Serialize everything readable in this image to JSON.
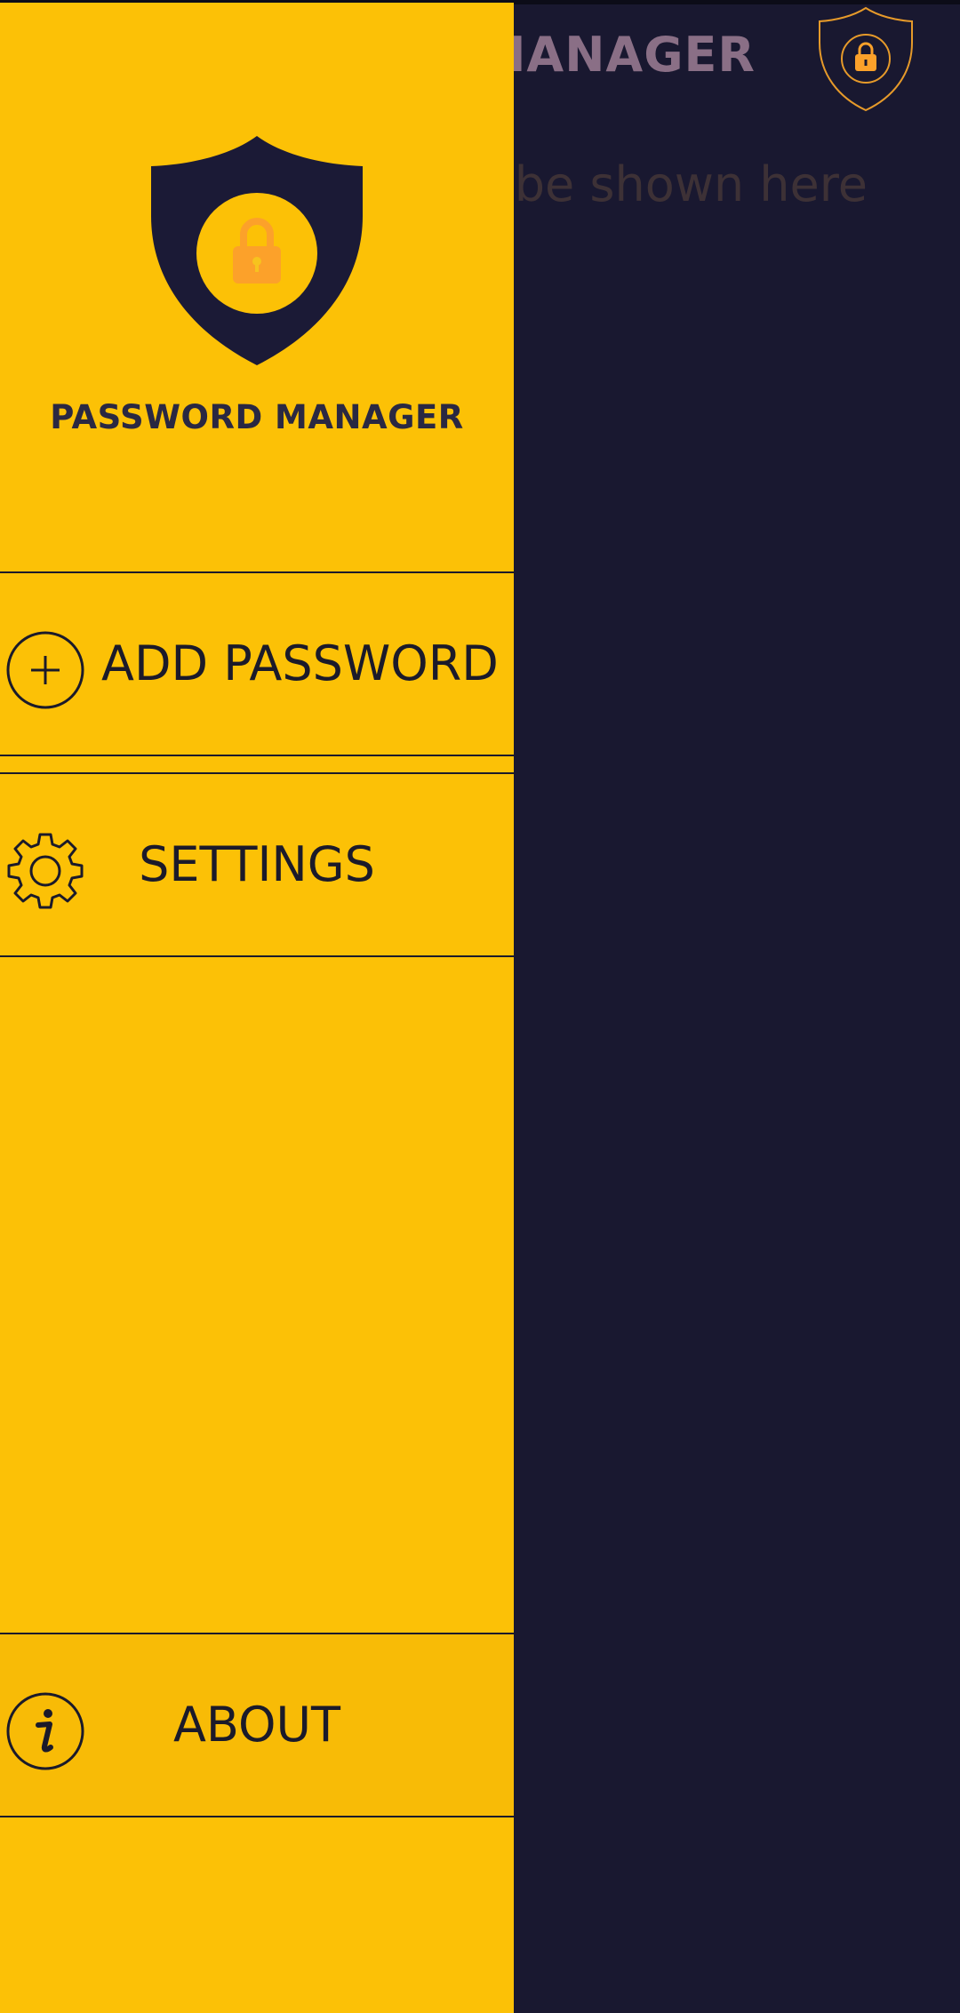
{
  "app": {
    "title": "PASSWORD MANAGER",
    "empty_message": "Passwords will be shown here"
  },
  "drawer": {
    "title": "PASSWORD MANAGER",
    "items": [
      {
        "label": "ADD PASSWORD",
        "icon": "add-circle-icon"
      },
      {
        "label": "SETTINGS",
        "icon": "gear-icon"
      },
      {
        "label": "ABOUT",
        "icon": "info-icon"
      }
    ]
  },
  "colors": {
    "drawer_bg": "#fcc106",
    "app_bg": "#191830",
    "shield_dark": "#1b1a36",
    "lock_orange": "#fca12a",
    "text_dark": "#1b1a2a"
  }
}
